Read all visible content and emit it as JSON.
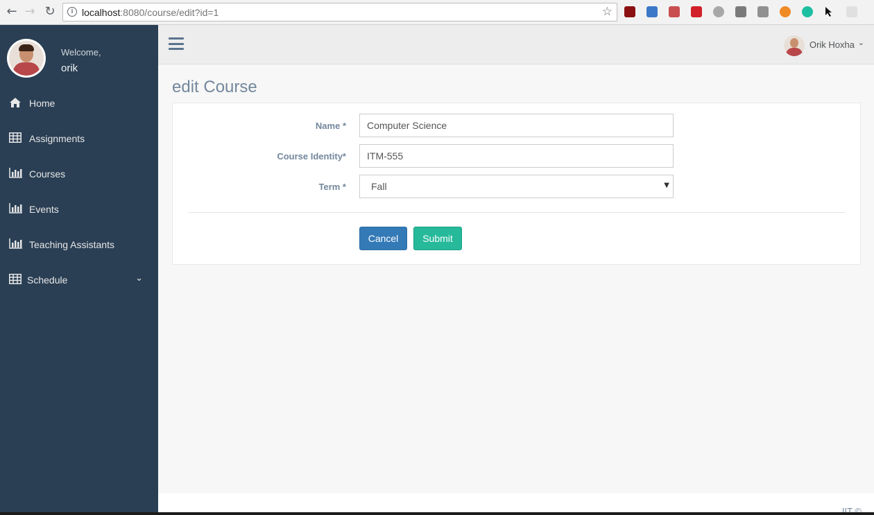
{
  "browser": {
    "url_host": "localhost",
    "url_rest": ":8080/course/edit?id=1"
  },
  "sidebar": {
    "welcome": "Welcome,",
    "username": "orik",
    "items": [
      {
        "label": "Home",
        "icon": "home-icon"
      },
      {
        "label": "Assignments",
        "icon": "table-icon"
      },
      {
        "label": "Courses",
        "icon": "bar-chart-icon"
      },
      {
        "label": "Events",
        "icon": "bar-chart-icon"
      },
      {
        "label": "Teaching Assistants",
        "icon": "bar-chart-icon"
      },
      {
        "label": "Schedule",
        "icon": "table-icon"
      }
    ]
  },
  "topnav": {
    "user_name": "Orik Hoxha"
  },
  "page": {
    "title": "edit Course"
  },
  "form": {
    "name_label": "Name *",
    "name_value": "Computer Science",
    "identity_label": "Course Identity*",
    "identity_value": "ITM-555",
    "term_label": "Term *",
    "term_value": "Fall",
    "cancel_label": "Cancel",
    "submit_label": "Submit"
  },
  "footer": {
    "text": "IIT ©"
  },
  "colors": {
    "sidebar_bg": "#2A3F54",
    "primary": "#337AB7",
    "success": "#26B99A"
  }
}
